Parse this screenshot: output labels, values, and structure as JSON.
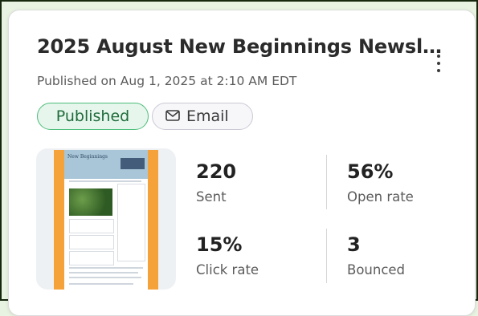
{
  "card": {
    "title": "2025 August New Beginnings Newsl…",
    "subtitle": "Published on Aug 1, 2025 at 2:10 AM EDT",
    "menu_icon": "more-vertical-icon",
    "badges": {
      "status": "Published",
      "channel": "Email",
      "channel_icon": "envelope-icon"
    },
    "thumbnail": {
      "heading": "New Beginnings",
      "accent_color": "#f5a23a",
      "header_color": "#a9c6d8"
    },
    "stats": [
      {
        "value": "220",
        "label": "Sent"
      },
      {
        "value": "56%",
        "label": "Open rate"
      },
      {
        "value": "15%",
        "label": "Click rate"
      },
      {
        "value": "3",
        "label": "Bounced"
      }
    ],
    "colors": {
      "published_bg": "#e6f6ec",
      "published_border": "#4cbd79",
      "page_bg": "#e8f3e1"
    }
  }
}
